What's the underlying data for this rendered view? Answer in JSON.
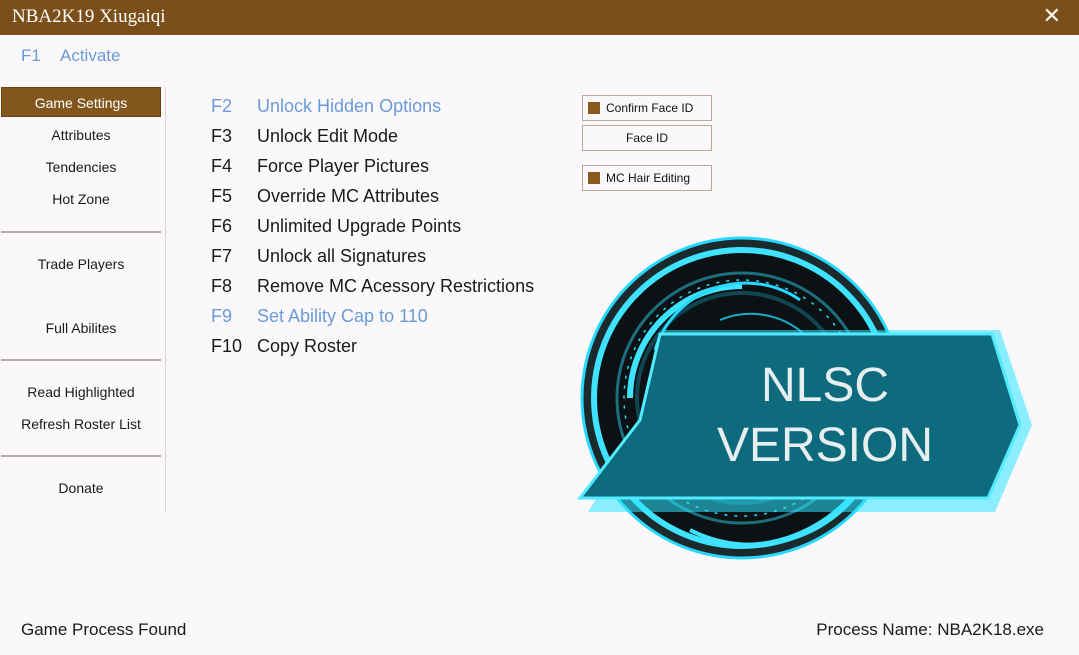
{
  "window": {
    "title": "NBA2K19 Xiugaiqi",
    "close_glyph": "✕"
  },
  "activate": {
    "key": "F1",
    "label": "Activate"
  },
  "sidebar": {
    "items": [
      {
        "label": "Game Settings"
      },
      {
        "label": "Attributes"
      },
      {
        "label": "Tendencies"
      },
      {
        "label": "Hot Zone"
      },
      {
        "label": "Trade Players"
      },
      {
        "label": "Full Abilites"
      },
      {
        "label": "Read Highlighted"
      },
      {
        "label": "Refresh Roster List"
      },
      {
        "label": "Donate"
      }
    ]
  },
  "options": [
    {
      "key": "F2",
      "label": "Unlock Hidden Options"
    },
    {
      "key": "F3",
      "label": "Unlock Edit Mode"
    },
    {
      "key": "F4",
      "label": "Force Player Pictures"
    },
    {
      "key": "F5",
      "label": "Override MC Attributes"
    },
    {
      "key": "F6",
      "label": "Unlimited Upgrade Points"
    },
    {
      "key": "F7",
      "label": "Unlock all Signatures"
    },
    {
      "key": "F8",
      "label": "Remove MC Acessory Restrictions"
    },
    {
      "key": "F9",
      "label": "Set Ability Cap to 110"
    },
    {
      "key": "F10",
      "label": "Copy Roster"
    }
  ],
  "buttons": {
    "confirm_face_id": "Confirm Face ID",
    "face_id": "Face ID",
    "mc_hair_editing": "MC Hair Editing"
  },
  "logo": {
    "line1": "NLSC",
    "line2": "VERSION"
  },
  "status": {
    "left": "Game Process Found",
    "right": "Process Name: NBA2K18.exe"
  },
  "colors": {
    "titlebar": "#7a4f1a",
    "accent_brown": "#83561d",
    "highlight_blue": "#6a9bd8",
    "logo_teal": "#0e6b7e",
    "logo_glow": "#27d8ff"
  }
}
